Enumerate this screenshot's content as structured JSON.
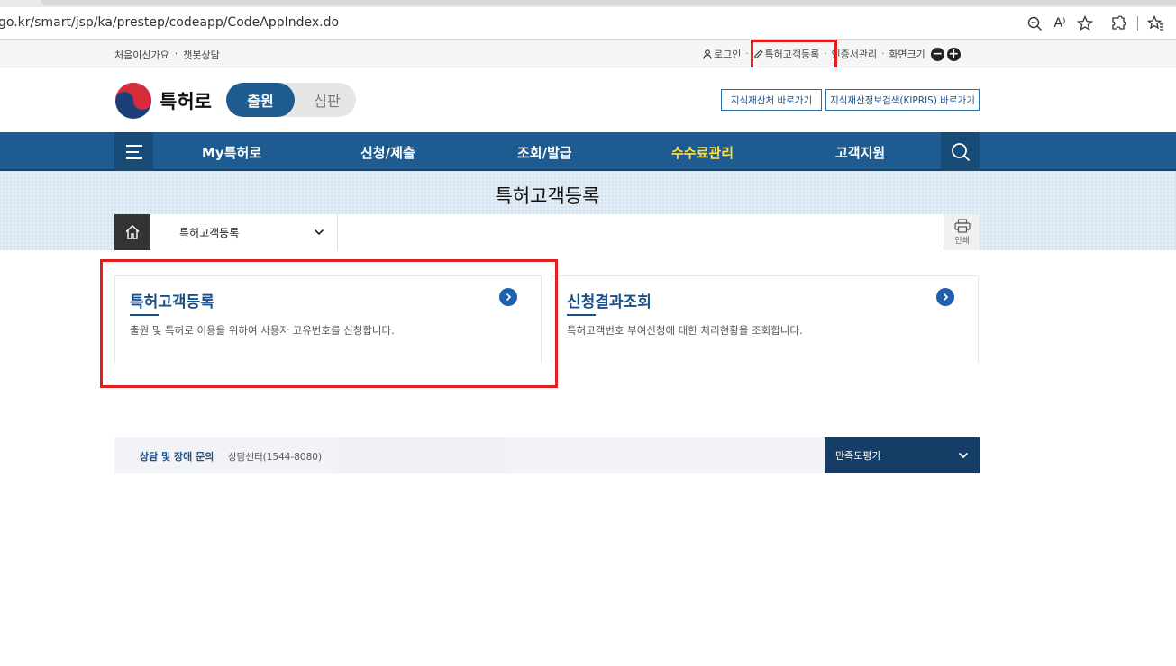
{
  "browser": {
    "url": "go.kr/smart/jsp/ka/prestep/codeapp/CodeAppIndex.do",
    "icons": [
      "zoom-out-icon",
      "read-aloud-icon",
      "favorite-star-icon",
      "extensions-icon",
      "favorites-icon"
    ],
    "read_aloud_glyph": "A⁾"
  },
  "utility": {
    "first_visit": "처음이신가요",
    "chatbot": "챗봇상담",
    "login": "로그인",
    "register": "특허고객등록",
    "cert": "인증서관리",
    "screen_size": "화면크기",
    "zoom_out": "−",
    "zoom_in": "+"
  },
  "header": {
    "logo_text": "특허로",
    "toggle_on": "출원",
    "toggle_off": "심판",
    "btn_ip_office": "지식재산처 바로가기",
    "btn_kipris": "지식재산정보검색(KIPRIS) 바로가기"
  },
  "gnb": {
    "items": [
      "My특허로",
      "신청/제출",
      "조회/발급",
      "수수료관리",
      "고객지원"
    ],
    "active_index": 3,
    "active_color": "#ffe24a",
    "bar_color": "#1d5b90"
  },
  "page": {
    "title": "특허고객등록",
    "breadcrumb": "특허고객등록",
    "print_label": "인쇄"
  },
  "cards": [
    {
      "title": "특허고객등록",
      "desc": "출원 및 특허로 이용을 위하여 사용자 고유번호를 신청합니다."
    },
    {
      "title": "신청결과조회",
      "desc": "특허고객번호 부여신청에 대한 처리현황을 조회합니다."
    }
  ],
  "footer": {
    "consult_label": "상담 및 장애 문의",
    "consult_value": "상담센터(1544-8080)",
    "satisfaction": "만족도평가"
  },
  "highlight_color": "#e02020"
}
